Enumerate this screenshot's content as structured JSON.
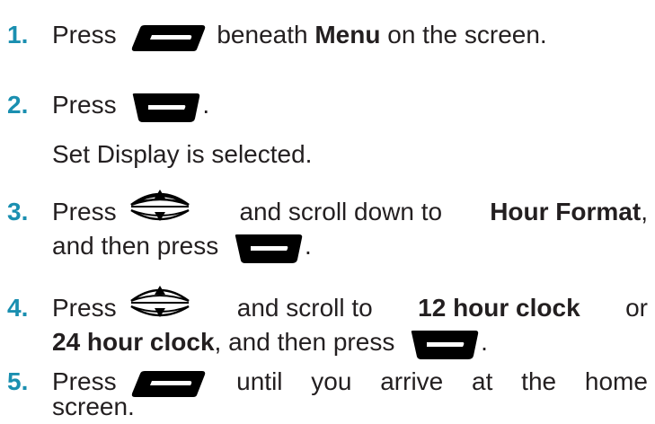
{
  "steps": [
    {
      "number": "1.",
      "press": "Press",
      "after_icon": "beneath",
      "bold": "Menu",
      "tail": "on the screen.",
      "icon": "left-softkey-icon"
    },
    {
      "number": "2.",
      "press": "Press",
      "tail": ".",
      "icon": "select-key-icon",
      "note": "Set Display is selected."
    },
    {
      "number": "3.",
      "press": "Press",
      "middle": "and scroll down to",
      "bold": "Hour Format",
      "tail": ",",
      "line2": "and then press",
      "line2_tail": ".",
      "icon": "navigation-key-icon",
      "icon2": "select-key-icon"
    },
    {
      "number": "4.",
      "press": "Press",
      "middle": "and scroll to",
      "bold": "12 hour clock",
      "or": "or",
      "bold2": "24 hour clock",
      "line2": ", and then press",
      "line2_tail": ".",
      "icon": "navigation-key-icon",
      "icon2": "select-key-icon"
    },
    {
      "number": "5.",
      "press": "Press",
      "w1": "until",
      "w2": "you",
      "w3": "arrive",
      "w4": "at",
      "w5": "the",
      "w6": "home",
      "line2": "screen.",
      "icon": "left-softkey-icon"
    }
  ],
  "colors": {
    "number": "#1a8fb0",
    "text": "#231f20",
    "icon": "#000000"
  }
}
